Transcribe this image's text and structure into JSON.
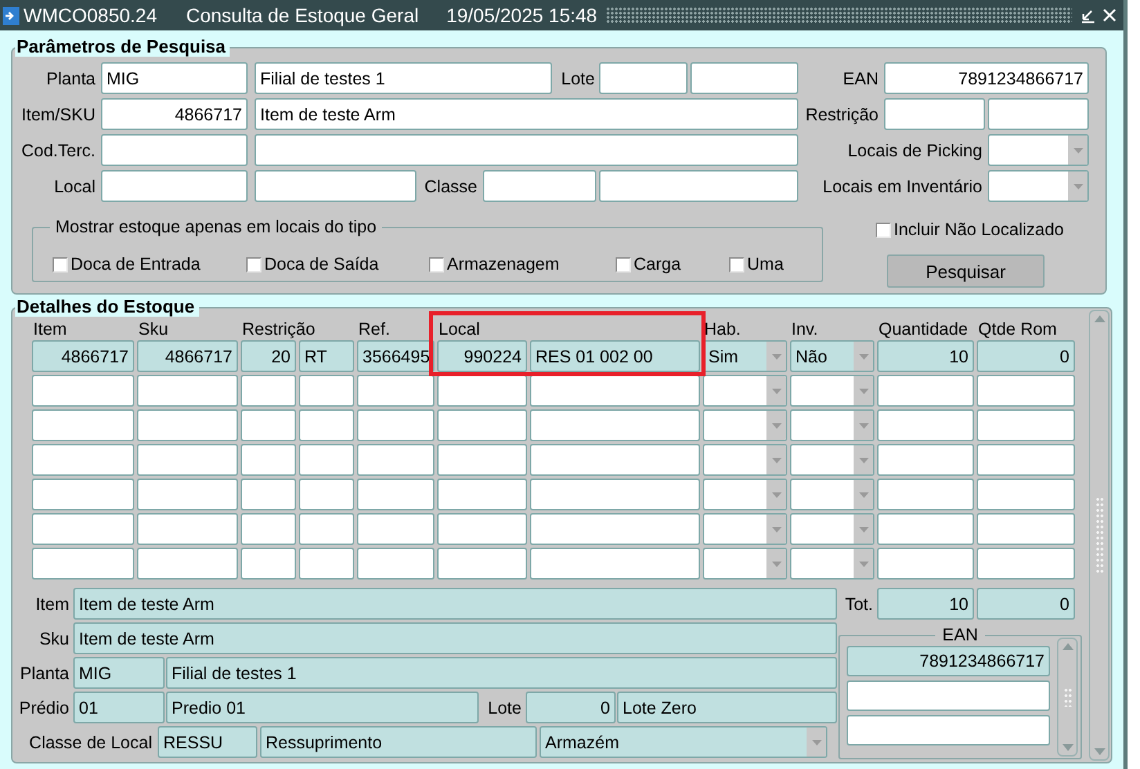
{
  "window": {
    "code": "WMCO0850.24",
    "title": "Consulta de Estoque Geral",
    "datetime": "19/05/2025 15:48"
  },
  "search": {
    "title": "Parâmetros de Pesquisa",
    "planta": {
      "label": "Planta",
      "code": "MIG",
      "name": "Filial de testes 1"
    },
    "lote": {
      "label": "Lote"
    },
    "ean": {
      "label": "EAN",
      "value": "7891234866717"
    },
    "item_sku": {
      "label": "Item/SKU",
      "code": "4866717",
      "name": "Item de teste Arm"
    },
    "restricao": {
      "label": "Restrição"
    },
    "cod_terc": {
      "label": "Cod.Terc."
    },
    "locais_picking": {
      "label": "Locais de Picking"
    },
    "local": {
      "label": "Local"
    },
    "classe": {
      "label": "Classe"
    },
    "locais_inventario": {
      "label": "Locais em Inventário"
    },
    "location_types": {
      "title": "Mostrar estoque apenas em locais do tipo",
      "options": [
        {
          "label": "Doca de Entrada",
          "checked": false
        },
        {
          "label": "Doca de Saída",
          "checked": false
        },
        {
          "label": "Armazenagem",
          "checked": false
        },
        {
          "label": "Carga",
          "checked": false
        },
        {
          "label": "Uma",
          "checked": false
        }
      ]
    },
    "incluir_nao_localizado": {
      "label": "Incluir Não Localizado",
      "checked": false
    },
    "search_button": "Pesquisar"
  },
  "details": {
    "title": "Detalhes do Estoque",
    "columns": [
      {
        "label": "Item",
        "highlighted": false
      },
      {
        "label": "Sku",
        "highlighted": false
      },
      {
        "label": "Restrição",
        "highlighted": false
      },
      {
        "label": "Ref.",
        "highlighted": false
      },
      {
        "label": "Local",
        "highlighted": true
      },
      {
        "label": "Hab.",
        "highlighted": false
      },
      {
        "label": "Inv.",
        "highlighted": false
      },
      {
        "label": "Quantidade",
        "highlighted": false
      },
      {
        "label": "Qtde Rom",
        "highlighted": false
      }
    ],
    "rows": [
      {
        "selected": true,
        "item": "4866717",
        "sku": "4866717",
        "restricao_code": "20",
        "restricao_type": "RT",
        "ref": "3566495",
        "local_code": "990224",
        "local_address": "RES 01 002 00",
        "hab": "Sim",
        "inv": "Não",
        "quantidade": "10",
        "qtde_rom": "0"
      },
      {
        "selected": false
      },
      {
        "selected": false
      },
      {
        "selected": false
      },
      {
        "selected": false
      },
      {
        "selected": false
      },
      {
        "selected": false
      }
    ],
    "summary": {
      "item": {
        "label": "Item",
        "value": "Item de teste Arm"
      },
      "sku": {
        "label": "Sku",
        "value": "Item de teste Arm"
      },
      "planta": {
        "label": "Planta",
        "code": "MIG",
        "name": "Filial de testes 1"
      },
      "predio": {
        "label": "Prédio",
        "code": "01",
        "name": "Predio 01"
      },
      "lote": {
        "label": "Lote",
        "code": "0",
        "name": "Lote Zero"
      },
      "classe_local": {
        "label": "Classe de Local",
        "code": "RESSU",
        "name": "Ressuprimento",
        "type": "Armazém"
      },
      "totals": {
        "label": "Tot.",
        "quantidade": "10",
        "qtde_rom": "0"
      },
      "ean_list": {
        "title": "EAN",
        "rows": [
          {
            "value": "7891234866717",
            "selected": true
          },
          {
            "selected": false
          },
          {
            "selected": false
          }
        ]
      }
    }
  }
}
